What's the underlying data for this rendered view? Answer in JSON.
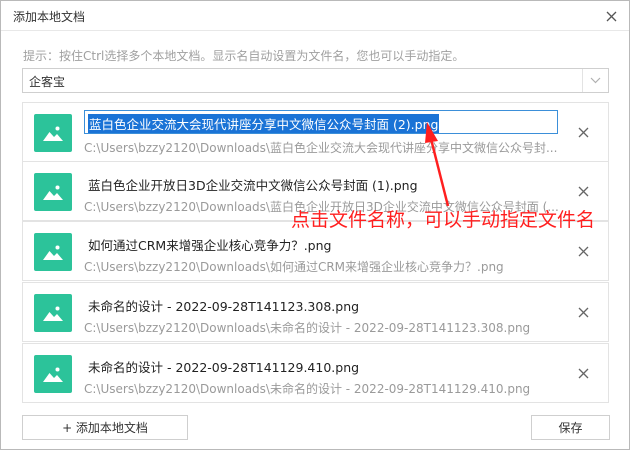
{
  "dialog": {
    "title": "添加本地文档",
    "hint": "提示：按住Ctrl选择多个本地文档。显示名自动设置为文件名，您也可以手动指定。",
    "selected_option": "企客宝",
    "files": [
      {
        "name": "蓝白色企业交流大会现代讲座分享中文微信公众号封面 (2).png",
        "path": "C:\\Users\\bzzy2120\\Downloads\\蓝白色企业交流大会现代讲座分享中文微信公众号封...",
        "editing": true
      },
      {
        "name": "蓝白色企业开放日3D企业交流中文微信公众号封面 (1).png",
        "path": "C:\\Users\\bzzy2120\\Downloads\\蓝白色企业开放日3D企业交流中文微信公众号封面 (..."
      },
      {
        "name": "如何通过CRM来增强企业核心竞争力？.png",
        "path": "C:\\Users\\bzzy2120\\Downloads\\如何通过CRM来增强企业核心竞争力？.png"
      },
      {
        "name": "未命名的设计 - 2022-09-28T141123.308.png",
        "path": "C:\\Users\\bzzy2120\\Downloads\\未命名的设计 - 2022-09-28T141123.308.png"
      },
      {
        "name": "未命名的设计 - 2022-09-28T141129.410.png",
        "path": "C:\\Users\\bzzy2120\\Downloads\\未命名的设计 - 2022-09-28T141129.410.png"
      }
    ],
    "add_button_label": "+ 添加本地文档",
    "save_button_label": "保存"
  },
  "annotation": {
    "text": "点击文件名称，可以手动指定文件名",
    "color": "#ff1f1f"
  },
  "colors": {
    "thumb": "#2cc39a",
    "selection": "#1a73d6",
    "input_border": "#3b8fd9"
  },
  "icons": {
    "close": "close-icon",
    "chevron": "chevron-down-icon",
    "image": "image-icon",
    "remove": "remove-icon"
  }
}
